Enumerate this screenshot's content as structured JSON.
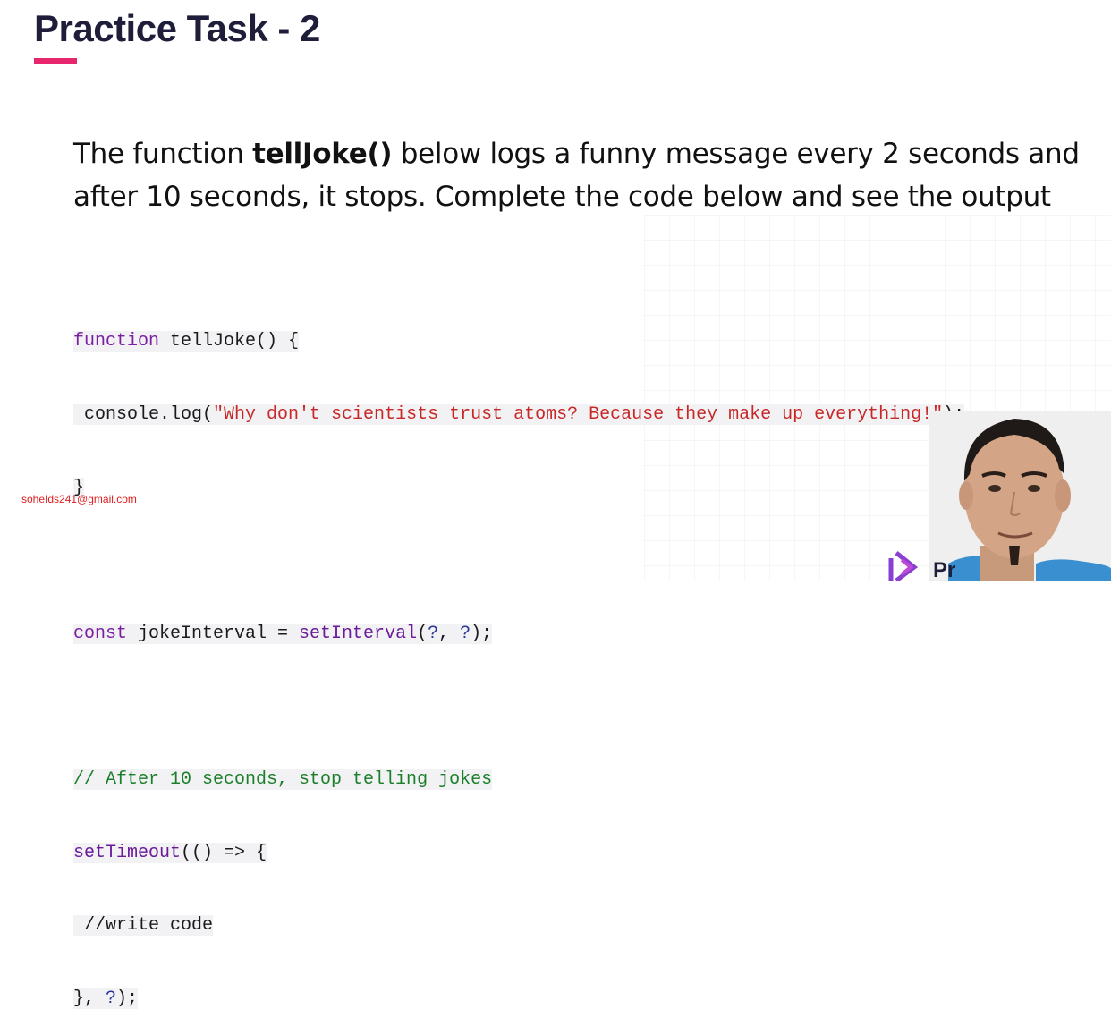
{
  "slide": {
    "title": "Practice Task - 2",
    "description": {
      "before": "The function ",
      "function_name": "tellJoke()",
      "after": " below logs a funny message every 2 seconds and after 10 seconds, it stops.  Complete the code below and see the output"
    },
    "code": {
      "line1": {
        "kw": "function",
        "rest": " tellJoke() {"
      },
      "line2": {
        "pre": " console.log(",
        "str": "\"Why don't scientists trust atoms? Because they make up everything!\"",
        "post": ");"
      },
      "line3": {
        "text": "}"
      },
      "line4": {
        "kw": "const",
        "mid": " jokeInterval = ",
        "fn": "setInterval",
        "open": "(",
        "q1": "?",
        "comma": ", ",
        "q2": "?",
        "close": ");"
      },
      "line5": {
        "comment": "// After 10 seconds, stop telling jokes"
      },
      "line6": {
        "fn": "setTimeout",
        "rest": "(() => {"
      },
      "line7": {
        "text": " //write code"
      },
      "line8": {
        "pre": "}, ",
        "q": "?",
        "post": ");"
      }
    },
    "email_watermark": "soheIds241@gmail.com",
    "logo_text": "Pr"
  },
  "colors": {
    "accent": "#e8266d",
    "title": "#1e1e3a",
    "keyword": "#7b1fa2",
    "string": "#c62828",
    "comment": "#1b7f2a"
  }
}
